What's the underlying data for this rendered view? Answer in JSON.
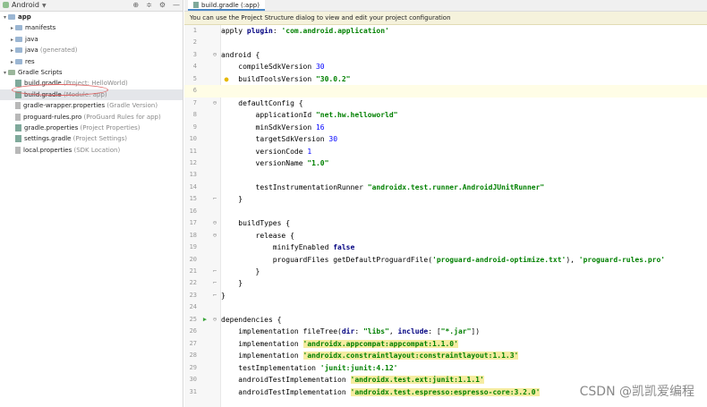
{
  "project_panel": {
    "view_selector": "Android",
    "tree": [
      {
        "label": "app",
        "hint": "",
        "level": 0,
        "icon": "folder",
        "expanded": true,
        "bold": true
      },
      {
        "label": "manifests",
        "hint": "",
        "level": 1,
        "icon": "folder",
        "expanded": false
      },
      {
        "label": "java",
        "hint": "",
        "level": 1,
        "icon": "folder",
        "expanded": false
      },
      {
        "label": "java",
        "hint": "(generated)",
        "level": 1,
        "icon": "folder",
        "expanded": false
      },
      {
        "label": "res",
        "hint": "",
        "level": 1,
        "icon": "folder",
        "expanded": false
      },
      {
        "label": "Gradle Scripts",
        "hint": "",
        "level": 0,
        "icon": "scripts",
        "expanded": true
      },
      {
        "label": "build.gradle",
        "hint": "(Project: HelloWorld)",
        "level": 1,
        "icon": "gfile"
      },
      {
        "label": "build.gradle",
        "hint": "(Module: app)",
        "level": 1,
        "icon": "gfile",
        "selected": true
      },
      {
        "label": "gradle-wrapper.properties",
        "hint": "(Gradle Version)",
        "level": 1,
        "icon": "pfile"
      },
      {
        "label": "proguard-rules.pro",
        "hint": "(ProGuard Rules for app)",
        "level": 1,
        "icon": "pfile"
      },
      {
        "label": "gradle.properties",
        "hint": "(Project Properties)",
        "level": 1,
        "icon": "gfile"
      },
      {
        "label": "settings.gradle",
        "hint": "(Project Settings)",
        "level": 1,
        "icon": "gfile"
      },
      {
        "label": "local.properties",
        "hint": "(SDK Location)",
        "level": 1,
        "icon": "pfile"
      }
    ]
  },
  "editor": {
    "tab_label": "build.gradle (:app)",
    "banner": "You can use the Project Structure dialog to view and edit your project configuration",
    "lines": [
      {
        "n": "1",
        "segs": [
          [
            "apply ",
            ""
          ],
          [
            "plugin",
            "kw"
          ],
          [
            ": ",
            ""
          ],
          [
            "'com.android.application'",
            "str"
          ]
        ]
      },
      {
        "n": "2",
        "segs": []
      },
      {
        "n": "3",
        "segs": [
          [
            "android {",
            ""
          ]
        ],
        "fold": "open"
      },
      {
        "n": "4",
        "segs": [
          [
            "    compileSdkVersion ",
            ""
          ],
          [
            "30",
            "num"
          ]
        ]
      },
      {
        "n": "5",
        "segs": [
          [
            "    buildToolsVersion ",
            ""
          ],
          [
            "\"30.0.2\"",
            "str"
          ]
        ],
        "bulb": true
      },
      {
        "n": "6",
        "segs": [],
        "current": true
      },
      {
        "n": "7",
        "segs": [
          [
            "    defaultConfig {",
            ""
          ]
        ],
        "fold": "open"
      },
      {
        "n": "8",
        "segs": [
          [
            "        applicationId ",
            ""
          ],
          [
            "\"net.hw.helloworld\"",
            "str"
          ]
        ]
      },
      {
        "n": "9",
        "segs": [
          [
            "        minSdkVersion ",
            ""
          ],
          [
            "16",
            "num"
          ]
        ]
      },
      {
        "n": "10",
        "segs": [
          [
            "        targetSdkVersion ",
            ""
          ],
          [
            "30",
            "num"
          ]
        ]
      },
      {
        "n": "11",
        "segs": [
          [
            "        versionCode ",
            ""
          ],
          [
            "1",
            "num"
          ]
        ]
      },
      {
        "n": "12",
        "segs": [
          [
            "        versionName ",
            ""
          ],
          [
            "\"1.0\"",
            "str"
          ]
        ]
      },
      {
        "n": "13",
        "segs": []
      },
      {
        "n": "14",
        "segs": [
          [
            "        testInstrumentationRunner ",
            ""
          ],
          [
            "\"androidx.test.runner.AndroidJUnitRunner\"",
            "str"
          ]
        ]
      },
      {
        "n": "15",
        "segs": [
          [
            "    }",
            ""
          ]
        ],
        "fold": "close"
      },
      {
        "n": "16",
        "segs": []
      },
      {
        "n": "17",
        "segs": [
          [
            "    buildTypes {",
            ""
          ]
        ],
        "fold": "open"
      },
      {
        "n": "18",
        "segs": [
          [
            "        release {",
            ""
          ]
        ],
        "fold": "open"
      },
      {
        "n": "19",
        "segs": [
          [
            "            minifyEnabled ",
            ""
          ],
          [
            "false",
            "kw"
          ]
        ]
      },
      {
        "n": "20",
        "segs": [
          [
            "            proguardFiles getDefaultProguardFile(",
            ""
          ],
          [
            "'proguard-android-optimize.txt'",
            "str"
          ],
          [
            "), ",
            ""
          ],
          [
            "'proguard-rules.pro'",
            "str"
          ]
        ]
      },
      {
        "n": "21",
        "segs": [
          [
            "        }",
            ""
          ]
        ],
        "fold": "close"
      },
      {
        "n": "22",
        "segs": [
          [
            "    }",
            ""
          ]
        ],
        "fold": "close"
      },
      {
        "n": "23",
        "segs": [
          [
            "}",
            ""
          ]
        ],
        "fold": "close"
      },
      {
        "n": "24",
        "segs": []
      },
      {
        "n": "25",
        "segs": [
          [
            "dependencies {",
            ""
          ]
        ],
        "fold": "open",
        "run": true
      },
      {
        "n": "26",
        "segs": [
          [
            "    implementation fileTree(",
            ""
          ],
          [
            "dir",
            "kw"
          ],
          [
            ": ",
            ""
          ],
          [
            "\"libs\"",
            "str"
          ],
          [
            ", ",
            ""
          ],
          [
            "include",
            "kw"
          ],
          [
            ": [",
            ""
          ],
          [
            "\"*.jar\"",
            "str"
          ],
          [
            "])",
            ""
          ]
        ]
      },
      {
        "n": "27",
        "segs": [
          [
            "    implementation ",
            ""
          ],
          [
            "'androidx.appcompat:appcompat:1.1.0'",
            "str hl"
          ]
        ]
      },
      {
        "n": "28",
        "segs": [
          [
            "    implementation ",
            ""
          ],
          [
            "'androidx.constraintlayout:constraintlayout:1.1.3'",
            "str hl"
          ]
        ]
      },
      {
        "n": "29",
        "segs": [
          [
            "    testImplementation ",
            ""
          ],
          [
            "'junit:junit:4.12'",
            "str"
          ]
        ]
      },
      {
        "n": "30",
        "segs": [
          [
            "    androidTestImplementation ",
            ""
          ],
          [
            "'androidx.test.ext:junit:1.1.1'",
            "str hl"
          ]
        ]
      },
      {
        "n": "31",
        "segs": [
          [
            "    androidTestImplementation ",
            ""
          ],
          [
            "'androidx.test.espresso:espresso-core:3.2.0'",
            "str hl"
          ]
        ]
      }
    ]
  },
  "watermark": "CSDN @凯凯爱编程",
  "icons": [
    "android-project-icon",
    "chevron-down-icon",
    "sync-icon",
    "collapse-icon",
    "settings-icon",
    "hide-icon",
    "folder-icon",
    "gradle-file-icon",
    "run-icon",
    "bulb-icon",
    "fold-icon"
  ]
}
